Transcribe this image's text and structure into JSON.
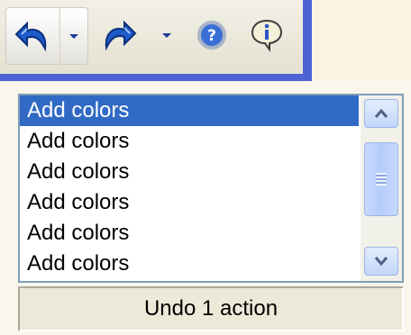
{
  "toolbar": {
    "buttons": [
      {
        "icon": "undo-icon"
      },
      {
        "icon": "dropdown-arrow-icon"
      },
      {
        "icon": "redo-icon"
      },
      {
        "icon": "dropdown-arrow-icon"
      },
      {
        "icon": "help-icon"
      },
      {
        "icon": "info-icon"
      }
    ]
  },
  "undo_list": {
    "items": [
      "Add colors",
      "Add colors",
      "Add colors",
      "Add colors",
      "Add colors",
      "Add colors"
    ],
    "selected_index": 0
  },
  "status": {
    "text": "Undo 1 action"
  },
  "colors": {
    "selection": "#316ac5",
    "toolbar_border": "#4d63d6",
    "icon_blue": "#1d5bc9"
  }
}
